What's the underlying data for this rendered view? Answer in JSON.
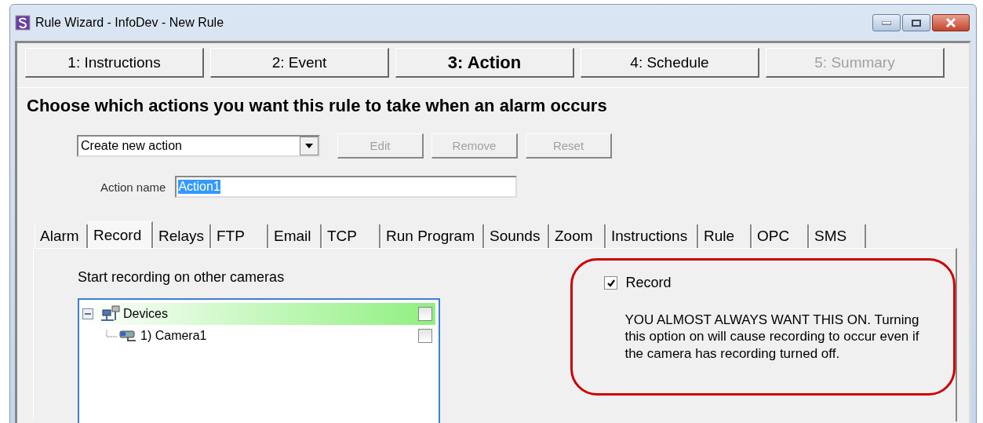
{
  "window": {
    "title": "Rule Wizard - InfoDev - New Rule"
  },
  "steps": [
    {
      "label": "1: Instructions",
      "selected": false,
      "disabled": false
    },
    {
      "label": "2: Event",
      "selected": false,
      "disabled": false
    },
    {
      "label": "3: Action",
      "selected": true,
      "disabled": false
    },
    {
      "label": "4: Schedule",
      "selected": false,
      "disabled": false
    },
    {
      "label": "5: Summary",
      "selected": false,
      "disabled": true
    }
  ],
  "heading": "Choose which actions you want this rule to take when an alarm occurs",
  "action_select": {
    "value": "Create new action"
  },
  "buttons": [
    {
      "label": "Edit",
      "disabled": true
    },
    {
      "label": "Remove",
      "disabled": true
    },
    {
      "label": "Reset",
      "disabled": true
    }
  ],
  "action_name": {
    "label": "Action name",
    "value": "Action1"
  },
  "tabs": [
    {
      "label": "Alarm",
      "selected": false
    },
    {
      "label": "Record",
      "selected": true
    },
    {
      "label": "Relays",
      "selected": false
    },
    {
      "label": "FTP",
      "selected": false
    },
    {
      "label": "Email",
      "selected": false
    },
    {
      "label": "TCP",
      "selected": false
    },
    {
      "label": "Run Program",
      "selected": false
    },
    {
      "label": "Sounds",
      "selected": false
    },
    {
      "label": "Zoom",
      "selected": false
    },
    {
      "label": "Instructions",
      "selected": false
    },
    {
      "label": "Rule",
      "selected": false
    },
    {
      "label": "OPC",
      "selected": false
    },
    {
      "label": "SMS",
      "selected": false
    }
  ],
  "cameras_label": "Start recording on other cameras",
  "tree": [
    {
      "label": "Devices",
      "kind": "group",
      "expanded": true,
      "selected": true,
      "checked": false,
      "children": [
        {
          "label": "1) Camera1",
          "kind": "camera",
          "selected": false,
          "checked": false
        }
      ]
    }
  ],
  "record": {
    "label": "Record",
    "checked": true,
    "note": "YOU ALMOST ALWAYS WANT THIS ON. Turning this option on will cause recording to occur even if the camera has recording turned off."
  }
}
